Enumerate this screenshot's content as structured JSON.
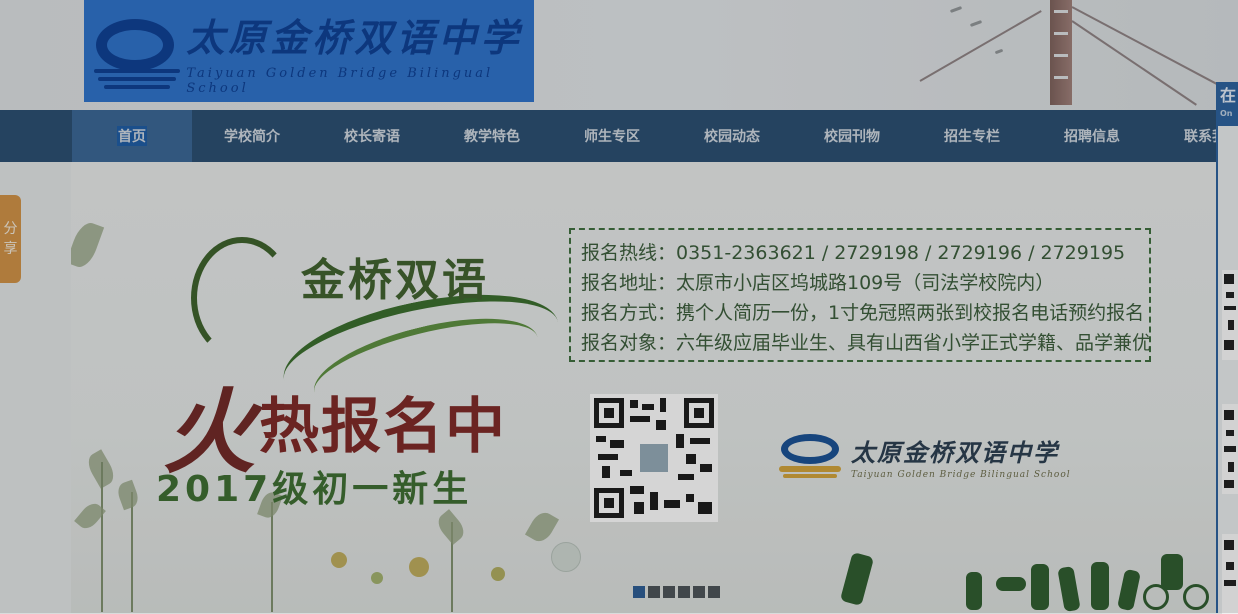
{
  "header": {
    "logo_cn": "太原金桥双语中学",
    "logo_en": "Taiyuan Golden Bridge Bilingual School"
  },
  "nav": {
    "items": [
      {
        "label": "首页",
        "active": true
      },
      {
        "label": "学校简介"
      },
      {
        "label": "校长寄语"
      },
      {
        "label": "教学特色"
      },
      {
        "label": "师生专区"
      },
      {
        "label": "校园动态"
      },
      {
        "label": "校园刊物"
      },
      {
        "label": "招生专栏"
      },
      {
        "label": "招聘信息"
      },
      {
        "label": "联系我"
      }
    ]
  },
  "banner": {
    "title": "金桥双语",
    "hot_first": "火",
    "hot_rest": "热报名中",
    "grade": "2017级初一新生",
    "info_lines": [
      "报名热线：0351-2363621  /  2729198 / 2729196 / 2729195",
      "报名地址：太原市小店区坞城路109号（司法学校院内）",
      "报名方式：携个人简历一份，1寸免冠照两张到校报名电话预约报名",
      "报名对象：六年级应届毕业生、具有山西省小学正式学籍、品学兼优"
    ],
    "logo_cn": "太原金桥双语中学",
    "logo_en": "Taiyuan Golden Bridge Bilingual School",
    "slide_count": 6,
    "active_slide": 0
  },
  "share_tab": {
    "label_1": "分",
    "label_2": "享"
  },
  "online_panel": {
    "title": "在",
    "subtitle": "On"
  },
  "colors": {
    "nav_bg": "#2b4d6e",
    "nav_active": "#3a6390",
    "logo_bg": "#2e6fc2",
    "share_tab": "#c88d45",
    "info_text": "#3b5a3b"
  }
}
